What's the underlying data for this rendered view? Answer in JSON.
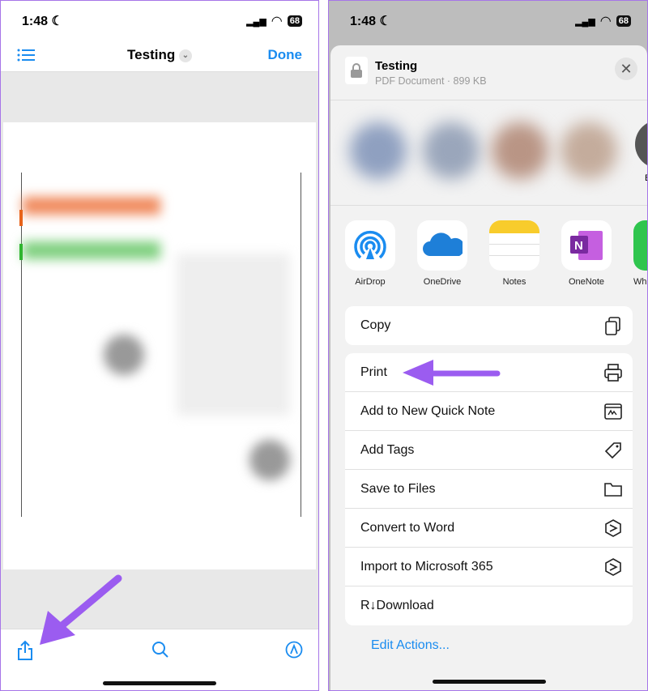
{
  "status": {
    "time": "1:48",
    "battery": "68"
  },
  "left": {
    "nav": {
      "title": "Testing",
      "done": "Done"
    },
    "toolbar": {
      "icons": [
        "share-icon",
        "search-icon",
        "markup-icon"
      ]
    }
  },
  "right": {
    "sheet": {
      "title": "Testing",
      "subtitle": "PDF Document · 899 KB"
    },
    "apps": [
      {
        "label": "AirDrop"
      },
      {
        "label": "OneDrive"
      },
      {
        "label": "Notes"
      },
      {
        "label": "OneNote"
      },
      {
        "label": "Wh"
      }
    ],
    "contact_partial": "B",
    "actions": {
      "copy": "Copy",
      "rows": [
        "Print",
        "Add to New Quick Note",
        "Add Tags",
        "Save to Files",
        "Convert to Word",
        "Import to Microsoft 365",
        "R↓Download"
      ]
    },
    "edit_actions": "Edit Actions..."
  },
  "colors": {
    "accent": "#1a8cf0",
    "arrow": "#9b5cf0",
    "border": "#a675e8"
  }
}
